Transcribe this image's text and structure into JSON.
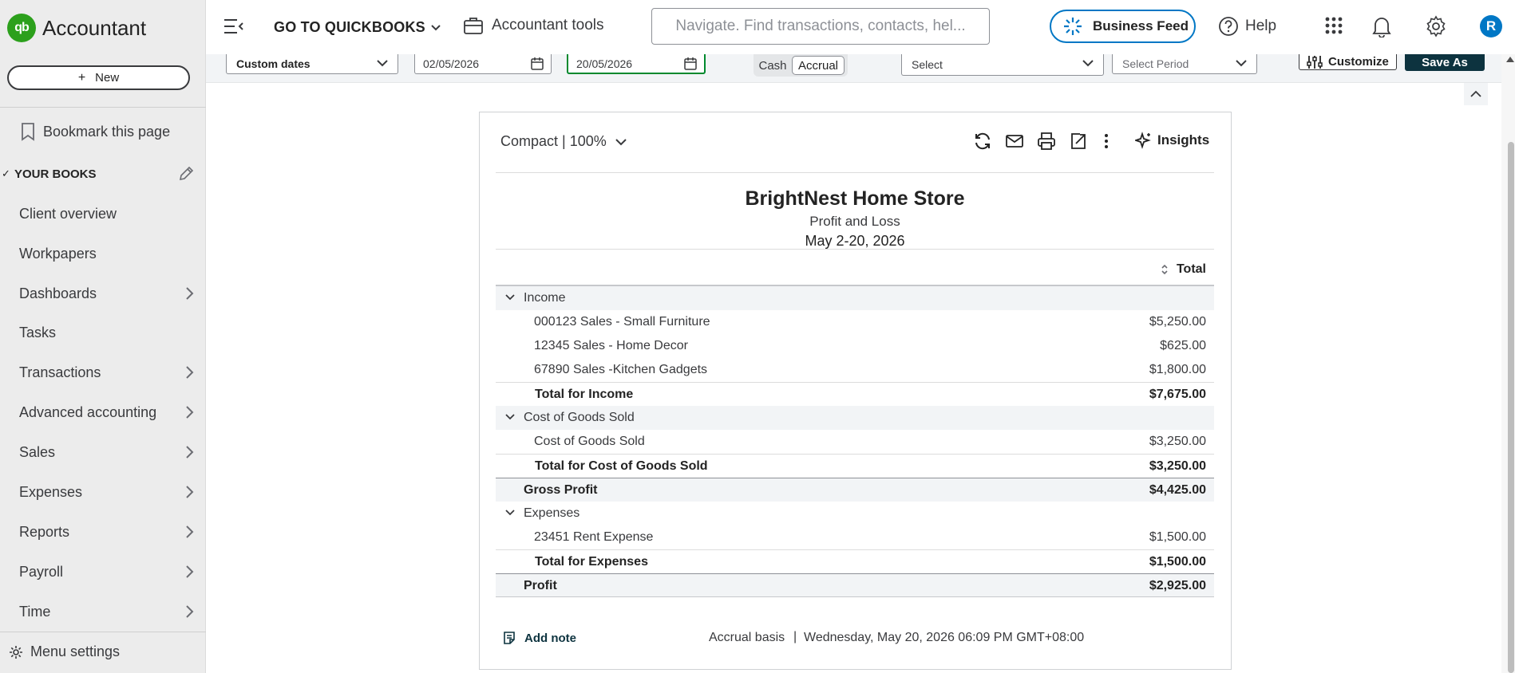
{
  "sidebar": {
    "brand_mark": "qb",
    "brand": "Accountant",
    "new_label": "New",
    "bookmark_label": "Bookmark this page",
    "your_books": "YOUR BOOKS",
    "items": [
      {
        "label": "Client overview"
      },
      {
        "label": "Workpapers"
      },
      {
        "label": "Dashboards"
      },
      {
        "label": "Tasks"
      },
      {
        "label": "Transactions"
      },
      {
        "label": "Advanced accounting"
      },
      {
        "label": "Sales"
      },
      {
        "label": "Expenses"
      },
      {
        "label": "Reports"
      },
      {
        "label": "Payroll"
      },
      {
        "label": "Time"
      }
    ],
    "menu_settings": "Menu settings"
  },
  "topbar": {
    "goto": "GO TO QUICKBOOKS",
    "accountant_tools": "Accountant tools",
    "search_placeholder": "Navigate. Find transactions, contacts, hel...",
    "business_feed": "Business Feed",
    "help": "Help",
    "avatar_initial": "R"
  },
  "filters": {
    "period": "Custom dates",
    "from_date": "02/05/2026",
    "to_date": "20/05/2026",
    "cash": "Cash",
    "accrual": "Accrual",
    "select": "Select",
    "select_period": "Select Period",
    "customize": "Customize",
    "save_as": "Save As"
  },
  "report": {
    "view": "Compact | 100%",
    "insights": "Insights",
    "company": "BrightNest Home Store",
    "name": "Profit and Loss",
    "dates": "May 2-20, 2026",
    "column": "Total",
    "rows": [
      {
        "label": "Income",
        "value": ""
      },
      {
        "label": "000123 Sales - Small Furniture",
        "value": "$5,250.00"
      },
      {
        "label": "12345 Sales - Home Decor",
        "value": "$625.00"
      },
      {
        "label": "67890 Sales -Kitchen Gadgets",
        "value": "$1,800.00"
      },
      {
        "label": "Total for Income",
        "value": "$7,675.00"
      },
      {
        "label": "Cost of Goods Sold",
        "value": ""
      },
      {
        "label": "Cost of Goods Sold",
        "value": "$3,250.00"
      },
      {
        "label": "Total for Cost of Goods Sold",
        "value": "$3,250.00"
      },
      {
        "label": "Gross Profit",
        "value": "$4,425.00"
      },
      {
        "label": "Expenses",
        "value": ""
      },
      {
        "label": "23451 Rent Expense",
        "value": "$1,500.00"
      },
      {
        "label": "Total for Expenses",
        "value": "$1,500.00"
      },
      {
        "label": "Profit",
        "value": "$2,925.00"
      }
    ],
    "add_note": "Add note",
    "basis": "Accrual basis",
    "separator": "|",
    "timestamp": "Wednesday, May 20, 2026 06:09 PM GMT+08:00"
  },
  "colors": {
    "brand_green": "#2ca01c",
    "accent_blue": "#0077c5",
    "save_button": "#0d333f",
    "active_field": "#00892e"
  }
}
